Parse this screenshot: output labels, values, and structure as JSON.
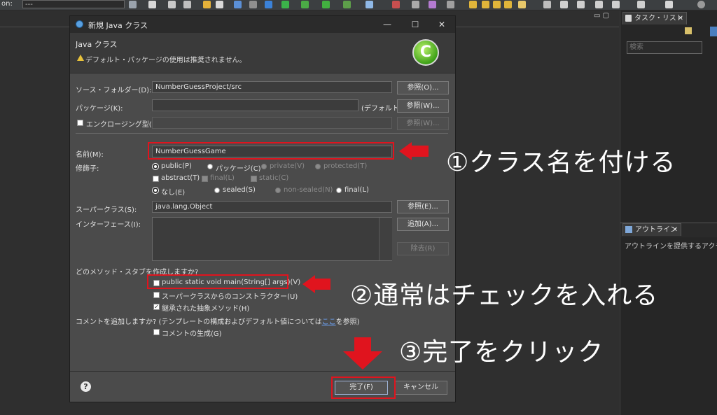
{
  "ide": {
    "toolbar_on_label": "on:",
    "toolbar_combo_value": "---",
    "task_tab_label": "タスク・リスト",
    "task_search_placeholder": "検索",
    "outline_tab_label": "アウトライン",
    "outline_message": "アウトラインを提供するアクティブな",
    "panel_controls": "▭ ▢"
  },
  "dialog": {
    "title": "新規 Java クラス",
    "window_buttons": {
      "minimize": "—",
      "maximize": "☐",
      "close": "✕"
    },
    "banner_title": "Java クラス",
    "banner_message": "デフォルト・パッケージの使用は推奨されません。",
    "banner_logo_glyph": "C",
    "source_folder": {
      "label": "ソース・フォルダー(D):",
      "value": "NumberGuessProject/src",
      "button": "参照(O)..."
    },
    "package": {
      "label": "パッケージ(K):",
      "value": "",
      "default_hint": "(デフォルト)",
      "button": "参照(W)..."
    },
    "enclosing": {
      "label": "エンクロージング型(Y):",
      "value": "",
      "button": "参照(W)..."
    },
    "name": {
      "label": "名前(M):",
      "value": "NumberGuessGame"
    },
    "modifiers": {
      "label": "修飾子:",
      "access": [
        {
          "label": "public(P)",
          "selected": true,
          "enabled": true
        },
        {
          "label": "パッケージ(C)",
          "selected": false,
          "enabled": true
        },
        {
          "label": "private(V)",
          "selected": false,
          "enabled": false
        },
        {
          "label": "protected(T)",
          "selected": false,
          "enabled": false
        }
      ],
      "flags": [
        {
          "label": "abstract(T)",
          "enabled": true
        },
        {
          "label": "final(L)",
          "enabled": false
        },
        {
          "label": "static(C)",
          "enabled": false
        }
      ],
      "sealing": [
        {
          "label": "なし(E)",
          "selected": true,
          "enabled": true
        },
        {
          "label": "sealed(S)",
          "selected": false,
          "enabled": true
        },
        {
          "label": "non-sealed(N)",
          "selected": false,
          "enabled": false
        },
        {
          "label": "final(L)",
          "selected": false,
          "enabled": true
        }
      ]
    },
    "superclass": {
      "label": "スーパークラス(S):",
      "value": "java.lang.Object",
      "button": "参照(E)..."
    },
    "interfaces": {
      "label": "インターフェース(I):",
      "add_button": "追加(A)...",
      "remove_button": "除去(R)"
    },
    "stubs": {
      "question": "どのメソッド・スタブを作成しますか?",
      "items": [
        {
          "label": "public static void main(String[] args)(V)",
          "checked": false
        },
        {
          "label": "スーパークラスからのコンストラクター(U)",
          "checked": false
        },
        {
          "label": "継承された抽象メソッド(H)",
          "checked": true
        }
      ]
    },
    "comments": {
      "question_prefix": "コメントを追加しますか? (テンプレートの構成およびデフォルト値については",
      "question_link": "ここ",
      "question_suffix": "を参照)",
      "generate_label": "コメントの生成(G)",
      "checked": false
    },
    "footer": {
      "help": "?",
      "finish": "完了(F)",
      "cancel": "キャンセル"
    }
  },
  "annotations": {
    "callout1": "①クラス名を付ける",
    "callout2": "②通常はチェックを入れる",
    "callout3": "③完了をクリック",
    "accent_color": "#e0141e"
  }
}
